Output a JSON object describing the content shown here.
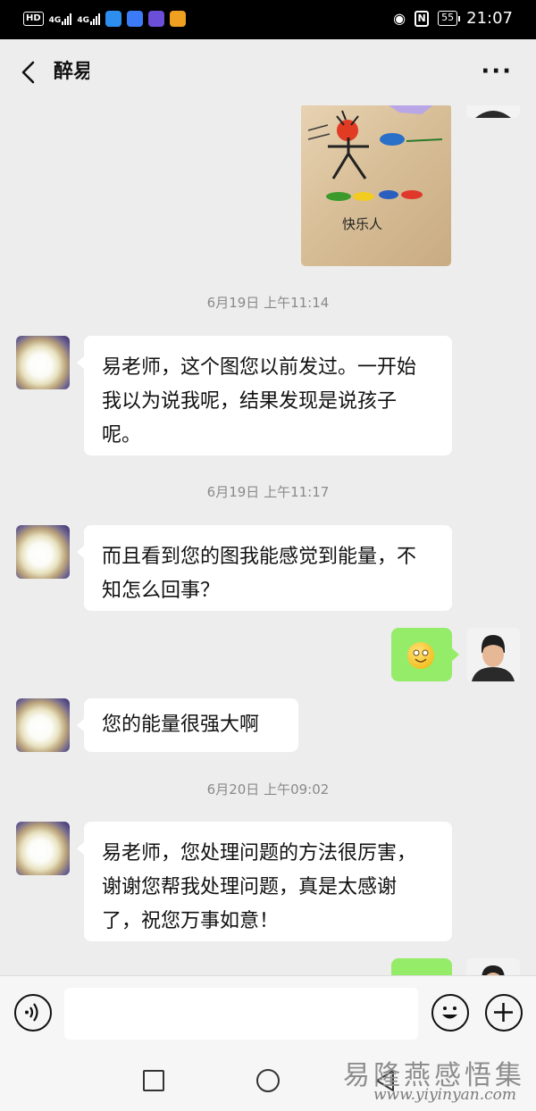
{
  "status_bar": {
    "hd_label": "HD",
    "network_1": "4G",
    "network_2": "4G",
    "battery": "55",
    "time": "21:07"
  },
  "header": {
    "title": "醉易"
  },
  "image_message": {
    "caption": "快乐人"
  },
  "messages": [
    {
      "type": "timestamp",
      "text": "6月19日 上午11:14"
    },
    {
      "type": "received",
      "text": "易老师，这个图您以前发过。一开始我以为说我呢，结果发现是说孩子呢。"
    },
    {
      "type": "timestamp",
      "text": "6月19日 上午11:17"
    },
    {
      "type": "received",
      "text": "而且看到您的图我能感觉到能量，不知怎么回事？"
    },
    {
      "type": "sent_emoji",
      "emoji": "smiling-face-emoji"
    },
    {
      "type": "received",
      "text": "您的能量很强大啊"
    },
    {
      "type": "timestamp",
      "text": "6月20日 上午09:02"
    },
    {
      "type": "received",
      "text": "易老师，您处理问题的方法很厉害，谢谢您帮我处理问题，真是太感谢了，祝您万事如意！"
    }
  ],
  "watermark": {
    "line1": "易隆燕感悟集",
    "line2": "www.yiyinyan.com"
  },
  "colors": {
    "sent_bubble": "#95ec69",
    "received_bubble": "#ffffff",
    "background": "#ededed"
  }
}
